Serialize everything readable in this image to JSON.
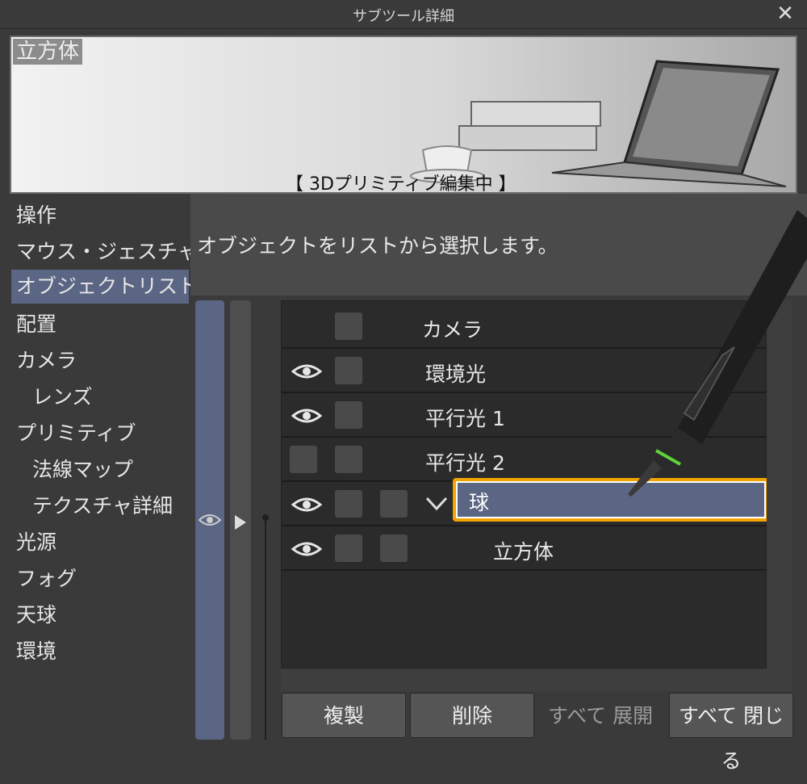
{
  "window": {
    "title": "サブツール詳細",
    "close_glyph": "✕"
  },
  "preview": {
    "tag": "立方体",
    "caption": "【 3Dプリミティブ編集中 】"
  },
  "sidebar": {
    "items": [
      {
        "label": "操作",
        "sub": false,
        "selected": false
      },
      {
        "label": "マウス・ジェスチャー",
        "sub": false,
        "selected": false
      },
      {
        "label": "オブジェクトリスト",
        "sub": false,
        "selected": true
      },
      {
        "label": "配置",
        "sub": false,
        "selected": false
      },
      {
        "label": "カメラ",
        "sub": false,
        "selected": false
      },
      {
        "label": "レンズ",
        "sub": true,
        "selected": false
      },
      {
        "label": "プリミティブ",
        "sub": false,
        "selected": false
      },
      {
        "label": "法線マップ",
        "sub": true,
        "selected": false
      },
      {
        "label": "テクスチャ詳細",
        "sub": true,
        "selected": false
      },
      {
        "label": "光源",
        "sub": false,
        "selected": false
      },
      {
        "label": "フォグ",
        "sub": false,
        "selected": false
      },
      {
        "label": "天球",
        "sub": false,
        "selected": false
      },
      {
        "label": "環境",
        "sub": false,
        "selected": false
      }
    ]
  },
  "description": "オブジェクトをリストから選択します。",
  "object_list": {
    "rows": [
      {
        "label": "カメラ",
        "eye": false,
        "boxes": 1
      },
      {
        "label": "環境光",
        "eye": true,
        "boxes": 1
      },
      {
        "label": "平行光 1",
        "eye": true,
        "boxes": 1
      },
      {
        "label": "平行光 2",
        "eye": false,
        "boxes": 2
      },
      {
        "label": "球",
        "eye": true,
        "boxes": 2,
        "selected": true,
        "expanded": true
      },
      {
        "label": "立方体",
        "eye": true,
        "boxes": 2,
        "child": true
      }
    ]
  },
  "buttons": {
    "duplicate": "複製",
    "delete": "削除",
    "expand_all": "すべて 展開",
    "collapse_all": "すべて 閉じる"
  },
  "colors": {
    "selection": "#5b6584",
    "highlight": "#f3a300",
    "pen_accent": "#5fd33a"
  }
}
